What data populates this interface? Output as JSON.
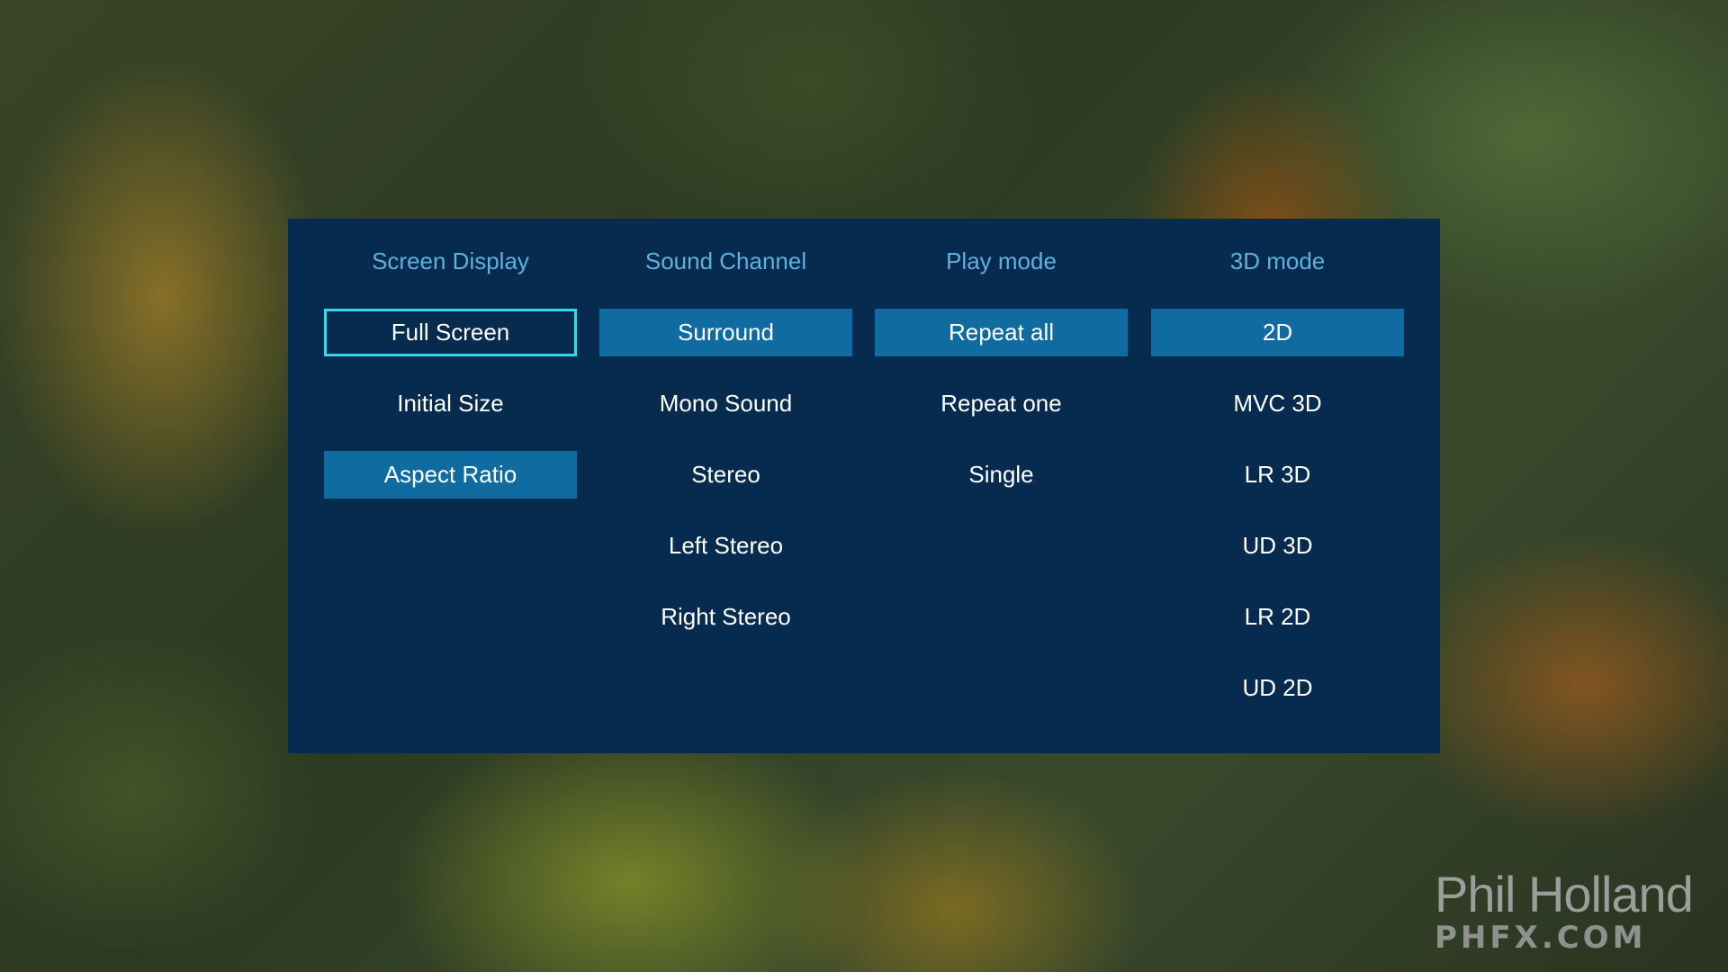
{
  "menu": {
    "columns": [
      {
        "header": "Screen Display",
        "options": [
          {
            "label": "Full Screen",
            "state": "focused"
          },
          {
            "label": "Initial Size",
            "state": "normal"
          },
          {
            "label": "Aspect Ratio",
            "state": "selected"
          }
        ]
      },
      {
        "header": "Sound Channel",
        "options": [
          {
            "label": "Surround",
            "state": "selected"
          },
          {
            "label": "Mono Sound",
            "state": "normal"
          },
          {
            "label": "Stereo",
            "state": "normal"
          },
          {
            "label": "Left Stereo",
            "state": "normal"
          },
          {
            "label": "Right Stereo",
            "state": "normal"
          }
        ]
      },
      {
        "header": "Play mode",
        "options": [
          {
            "label": "Repeat all",
            "state": "selected"
          },
          {
            "label": "Repeat one",
            "state": "normal"
          },
          {
            "label": "Single",
            "state": "normal"
          }
        ]
      },
      {
        "header": "3D mode",
        "options": [
          {
            "label": "2D",
            "state": "selected"
          },
          {
            "label": "MVC 3D",
            "state": "normal"
          },
          {
            "label": "LR 3D",
            "state": "normal"
          },
          {
            "label": "UD 3D",
            "state": "normal"
          },
          {
            "label": "LR 2D",
            "state": "normal"
          },
          {
            "label": "UD 2D",
            "state": "normal"
          }
        ]
      }
    ]
  },
  "watermark": {
    "name": "Phil Holland",
    "site": "PHFX.COM"
  },
  "colors": {
    "panel_bg": "#062b4e",
    "header_text": "#5fb0de",
    "selected_bg": "#0f6ba0",
    "focus_border": "#3ad6ec",
    "option_text": "#ffffff"
  }
}
